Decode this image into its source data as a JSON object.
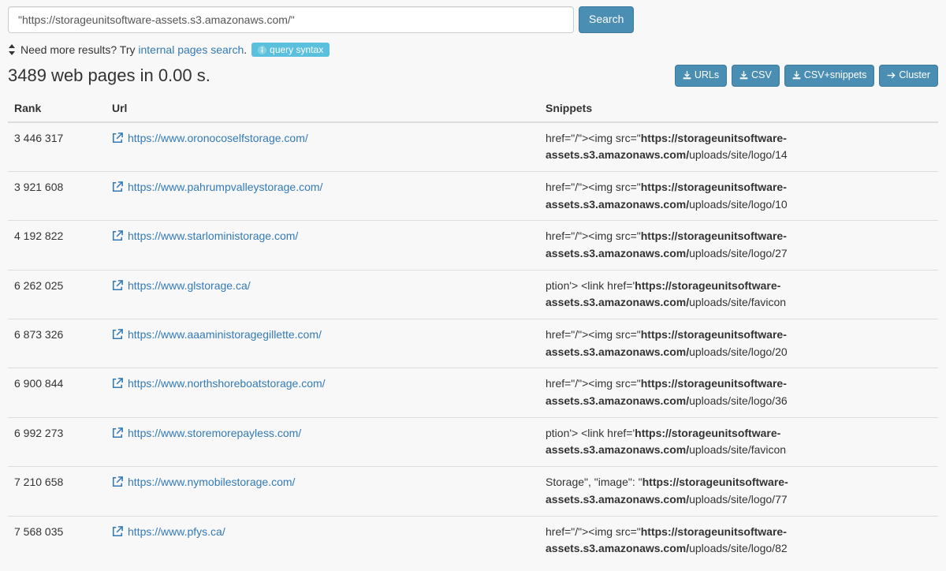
{
  "search": {
    "value": "\"https://storageunitsoftware-assets.s3.amazonaws.com/\"",
    "button_label": "Search"
  },
  "hint": {
    "prefix": "Need more results? Try ",
    "link_text": "internal pages search",
    "suffix": ".",
    "badge_text": "query syntax"
  },
  "summary": "3489 web pages in 0.00 s.",
  "export": {
    "urls": "URLs",
    "csv": "CSV",
    "csv_snippets": "CSV+snippets",
    "cluster": "Cluster"
  },
  "table": {
    "headers": {
      "rank": "Rank",
      "url": "Url",
      "snippets": "Snippets"
    },
    "rows": [
      {
        "rank": "3 446 317",
        "url": "https://www.oronocoselfstorage.com/",
        "snip_pre": "href=\"/\"><img src=\"",
        "snip_bold": "https://storageunitsoftware-assets.s3.amazonaws.com/",
        "snip_post": "uploads/site/logo/14"
      },
      {
        "rank": "3 921 608",
        "url": "https://www.pahrumpvalleystorage.com/",
        "snip_pre": "href=\"/\"><img src=\"",
        "snip_bold": "https://storageunitsoftware-assets.s3.amazonaws.com/",
        "snip_post": "uploads/site/logo/10"
      },
      {
        "rank": "4 192 822",
        "url": "https://www.starloministorage.com/",
        "snip_pre": "href=\"/\"><img src=\"",
        "snip_bold": "https://storageunitsoftware-assets.s3.amazonaws.com/",
        "snip_post": "uploads/site/logo/27"
      },
      {
        "rank": "6 262 025",
        "url": "https://www.glstorage.ca/",
        "snip_pre": "ption'> <link href='",
        "snip_bold": "https://storageunitsoftware-assets.s3.amazonaws.com/",
        "snip_post": "uploads/site/favicon"
      },
      {
        "rank": "6 873 326",
        "url": "https://www.aaaministoragegillette.com/",
        "snip_pre": "href=\"/\"><img src=\"",
        "snip_bold": "https://storageunitsoftware-assets.s3.amazonaws.com/",
        "snip_post": "uploads/site/logo/20"
      },
      {
        "rank": "6 900 844",
        "url": "https://www.northshoreboatstorage.com/",
        "snip_pre": "href=\"/\"><img src=\"",
        "snip_bold": "https://storageunitsoftware-assets.s3.amazonaws.com/",
        "snip_post": "uploads/site/logo/36"
      },
      {
        "rank": "6 992 273",
        "url": "https://www.storemorepayless.com/",
        "snip_pre": "ption'> <link href='",
        "snip_bold": "https://storageunitsoftware-assets.s3.amazonaws.com/",
        "snip_post": "uploads/site/favicon"
      },
      {
        "rank": "7 210 658",
        "url": "https://www.nymobilestorage.com/",
        "snip_pre": "Storage\", \"image\": \"",
        "snip_bold": "https://storageunitsoftware-assets.s3.amazonaws.com/",
        "snip_post": "uploads/site/logo/77"
      },
      {
        "rank": "7 568 035",
        "url": "https://www.pfys.ca/",
        "snip_pre": "href=\"/\"><img src=\"",
        "snip_bold": "https://storageunitsoftware-assets.s3.amazonaws.com/",
        "snip_post": "uploads/site/logo/82"
      }
    ]
  }
}
